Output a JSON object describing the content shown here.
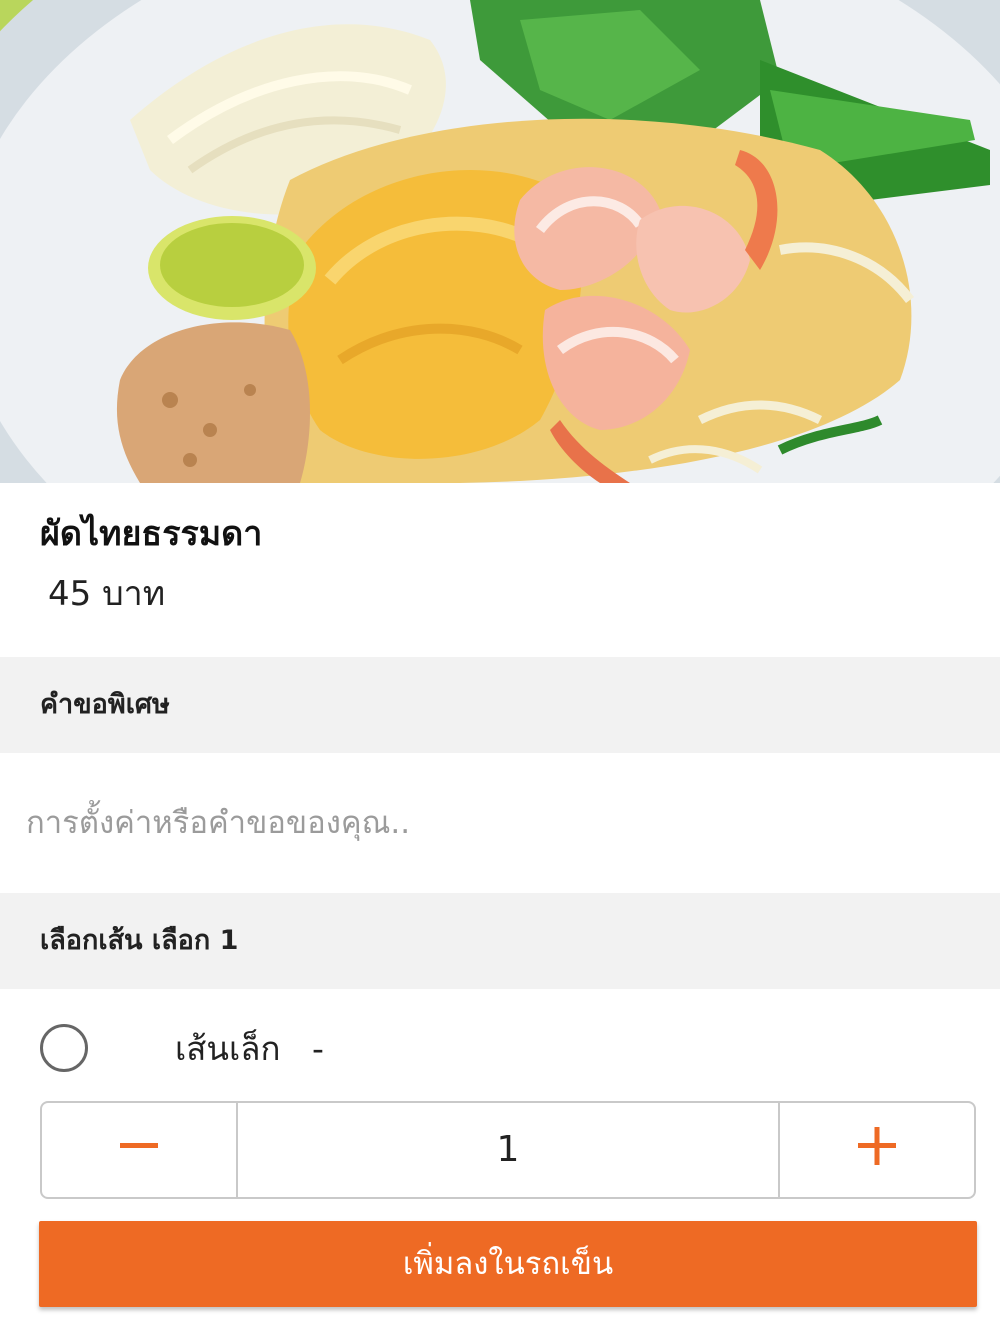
{
  "item": {
    "name": "ผัดไทยธรรมดา",
    "price": "45 บาท",
    "image_subject": "pad-thai-with-shrimp"
  },
  "special_request": {
    "header": "คำขอพิเศษ",
    "placeholder": "การตั้งค่าหรือคำขอของคุณ..",
    "value": ""
  },
  "noodle_choice": {
    "header": "เลือกเส้น เลือก 1",
    "options": [
      {
        "label": "เส้นเล็ก",
        "price": "-",
        "selected": false
      }
    ]
  },
  "quantity": {
    "value": "1",
    "minus_icon": "minus-icon",
    "plus_icon": "plus-icon"
  },
  "actions": {
    "add_to_cart": "เพิ่มลงในรถเข็น"
  },
  "colors": {
    "accent": "#ee6a24",
    "section_bg": "#f2f2f2",
    "border": "#c9c9c9"
  }
}
